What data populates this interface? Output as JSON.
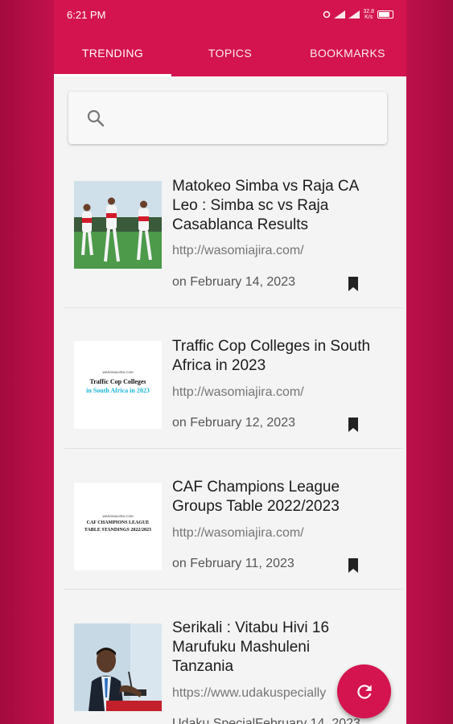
{
  "status": {
    "time": "6:21 PM",
    "speed_top": "32.8",
    "speed_bottom": "K/s"
  },
  "tabs": [
    {
      "label": "TRENDING"
    },
    {
      "label": "TOPICS"
    },
    {
      "label": "BOOKMARKS"
    }
  ],
  "search": {
    "placeholder": ""
  },
  "articles": [
    {
      "title": "Matokeo Simba vs Raja CA Leo : Simba sc vs Raja Casablanca Results",
      "url": "http://wasomiajira.com/",
      "date": "on February 14, 2023"
    },
    {
      "title": "Traffic Cop Colleges in South Africa in 2023",
      "url": "http://wasomiajira.com/",
      "date": "on February 12, 2023",
      "thumb_site": "WASOMIAJIRA.COM",
      "thumb_line1": "Traffic Cop Colleges",
      "thumb_line2": "in South Africa in 2023"
    },
    {
      "title": "CAF Champions League Groups Table 2022/2023",
      "url": "http://wasomiajira.com/",
      "date": "on February 11, 2023",
      "thumb_site": "WASOMIAJIRA.COM",
      "thumb_line1": "CAF CHAMPIONS LEAGUE",
      "thumb_line2": "TABLE STANDINGS 2022/2023"
    },
    {
      "title": "Serikali : Vitabu Hivi 16 Marufuku Mashuleni Tanzania",
      "url": "https://www.udakuspecially",
      "date": "Udaku SpecialFebruary 14, 2023"
    }
  ],
  "colors": {
    "primary": "#d4144e",
    "background": "#f4f4f4",
    "accent_cyan": "#19b8d8"
  },
  "icons": {
    "search": "search-icon",
    "bookmark": "bookmark-icon",
    "refresh": "refresh-icon"
  }
}
